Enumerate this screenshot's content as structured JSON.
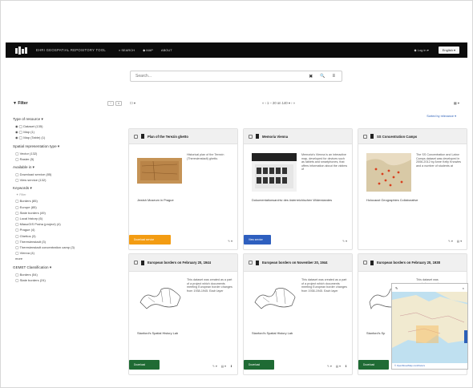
{
  "navbar": {
    "brand": "EHRI GEOSPATIAL REPOSITORY TOOL",
    "links": [
      "⌕ SEARCH",
      "◆ MAP",
      "ABOUT"
    ],
    "login": "◆ Log in ▾",
    "language": "English ▾"
  },
  "search": {
    "placeholder": "Search...",
    "clear": "✖",
    "go": "🔍",
    "options": "≡"
  },
  "filter": {
    "title": "▼ Filter",
    "collapse": "−",
    "close": "×",
    "type_title": "Type of resource ▾",
    "type_options": [
      "◉ ◯ Dataset (135)",
      "◉ ◯ Map (1)",
      "◉ ◯ Map (Table) (1)"
    ],
    "spatial_title": "Spatial representation type ▾",
    "spatial_options": [
      "◯ Vector (132)",
      "◯ Raster (5)"
    ],
    "available_title": "Available in ▾",
    "available_options": [
      "◯ Download service (85)",
      "◯ View service (132)"
    ],
    "keywords_title": "Keywords ▾",
    "keywords_input": "✦ Filter",
    "keywords_options": [
      "◯ Borders (85)",
      "◯ Europe (85)",
      "◯ State borders (49)",
      "◯ Local history (6)",
      "◯ MiasoGIS Praha (project) (4)",
      "◯ Prague (4)",
      "◯ Ghettos (3)",
      "◯ Theresienstadt (3)",
      "◯ Theresienstadt concentration camp (3)",
      "◯ Vienna (4)"
    ],
    "more": "more",
    "geo_title": "GEMET Classification ▾",
    "geo_options": [
      "◯ Borders (54)",
      "◯ State borders (24)"
    ]
  },
  "toolbar": {
    "select": "☐ ▾",
    "pager": "«  ‹  1 – 20 on 140 ▾  ›  »",
    "view": "▦ ▾",
    "sort": "Sorted by relevance ▾"
  },
  "cards": [
    {
      "title": "Plan of the Terezin ghetto",
      "desc": "Historical plan of the Terezín (Theresienstadt) ghetto.",
      "owner": "Jewish Museum in Prague",
      "badge": "Download service",
      "actions": [
        "✎ ▾"
      ]
    },
    {
      "title": "Memoria Vienna",
      "desc": "Memoria's Vienna is an interactive map, developed for devices such as tablets and smartphones, that offers information about the victims of",
      "owner": "Dokumentationsarchiv des österreichischen Widerstandes",
      "badge": "View service",
      "actions": [
        "✎ ▾"
      ]
    },
    {
      "title": "SS Concentration Camps",
      "desc": "The SS Concentration and Labor Camps dataset was developed in 2006-2012 by Anne Kelly Knowles and a number of students at",
      "owner": "Holocaust Geographies Collaborative",
      "badge": "",
      "actions": [
        "✎ ▾",
        "▤ ▾"
      ]
    },
    {
      "title": "European borders on February 20, 1944",
      "desc": "This dataset was created as a part of a project which documents meeting European border changes from 1938-1945. Each layer",
      "owner": "Stanford's Spatial History Lab",
      "badge": "Download",
      "actions": [
        "✎ ▾",
        "▤ ▾",
        "⬇"
      ]
    },
    {
      "title": "European borders on November 20, 1944",
      "desc": "This dataset was created as a part of a project which documents meeting European border changes from 1938-1945. Each layer",
      "owner": "Stanford's Spatial History Lab",
      "badge": "Download",
      "actions": [
        "✎ ▾",
        "▤ ▾",
        "⬇"
      ]
    },
    {
      "title": "European borders on February 20, 1938",
      "desc": "This dataset was created as a part",
      "owner": "Stanford's Sp",
      "badge": "Download",
      "actions": []
    }
  ],
  "map": {
    "close": "×",
    "edit": "✎",
    "footer": "© OpenStreetMap contributors"
  },
  "colors": {
    "orange_badge": "#f39c12",
    "blue_badge": "#2e5fbf",
    "green_badge": "#1f6b34",
    "navbar": "#0c0c0c"
  }
}
